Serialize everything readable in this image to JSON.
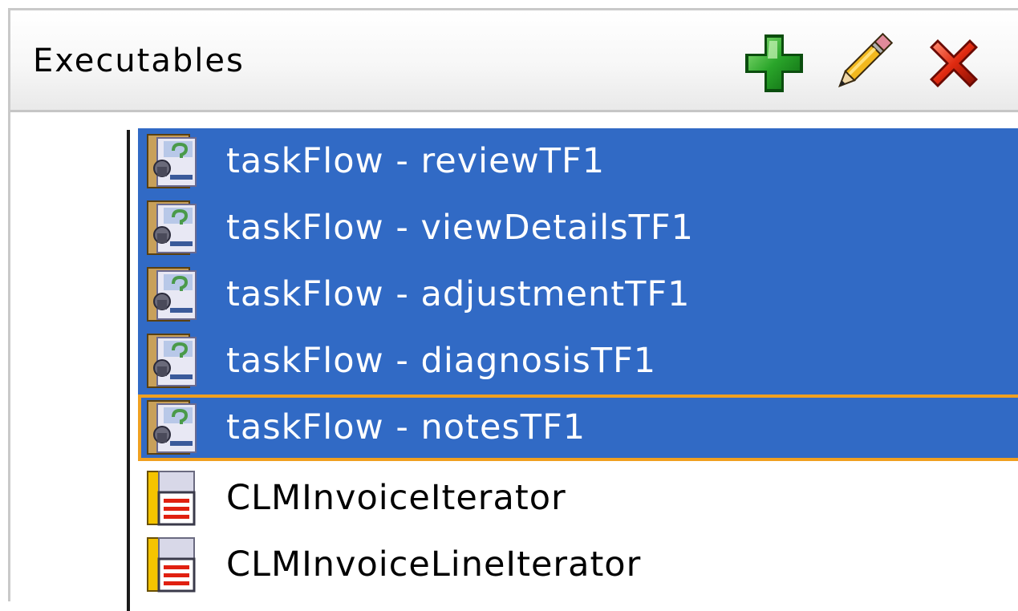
{
  "panel": {
    "title": "Executables",
    "toolbar": {
      "add_icon": "add-icon",
      "edit_icon": "pencil-icon",
      "delete_icon": "delete-icon"
    }
  },
  "tree": {
    "items": [
      {
        "label": "taskFlow - reviewTF1",
        "icon": "taskflow-binding-icon",
        "selected": true
      },
      {
        "label": "taskFlow - viewDetailsTF1",
        "icon": "taskflow-binding-icon",
        "selected": true
      },
      {
        "label": "taskFlow - adjustmentTF1",
        "icon": "taskflow-binding-icon",
        "selected": true
      },
      {
        "label": "taskFlow - diagnosisTF1",
        "icon": "taskflow-binding-icon",
        "selected": true
      },
      {
        "label": "taskFlow - notesTF1",
        "icon": "taskflow-binding-icon",
        "selected": true,
        "focused": true
      },
      {
        "label": "CLMInvoiceIterator",
        "icon": "iterator-icon",
        "selected": false
      },
      {
        "label": "CLMInvoiceLineIterator",
        "icon": "iterator-icon",
        "selected": false
      }
    ]
  },
  "colors": {
    "selection": "#316ac5",
    "focus_border": "#f0a020",
    "add": "#2aa52a",
    "delete": "#e02a10"
  }
}
